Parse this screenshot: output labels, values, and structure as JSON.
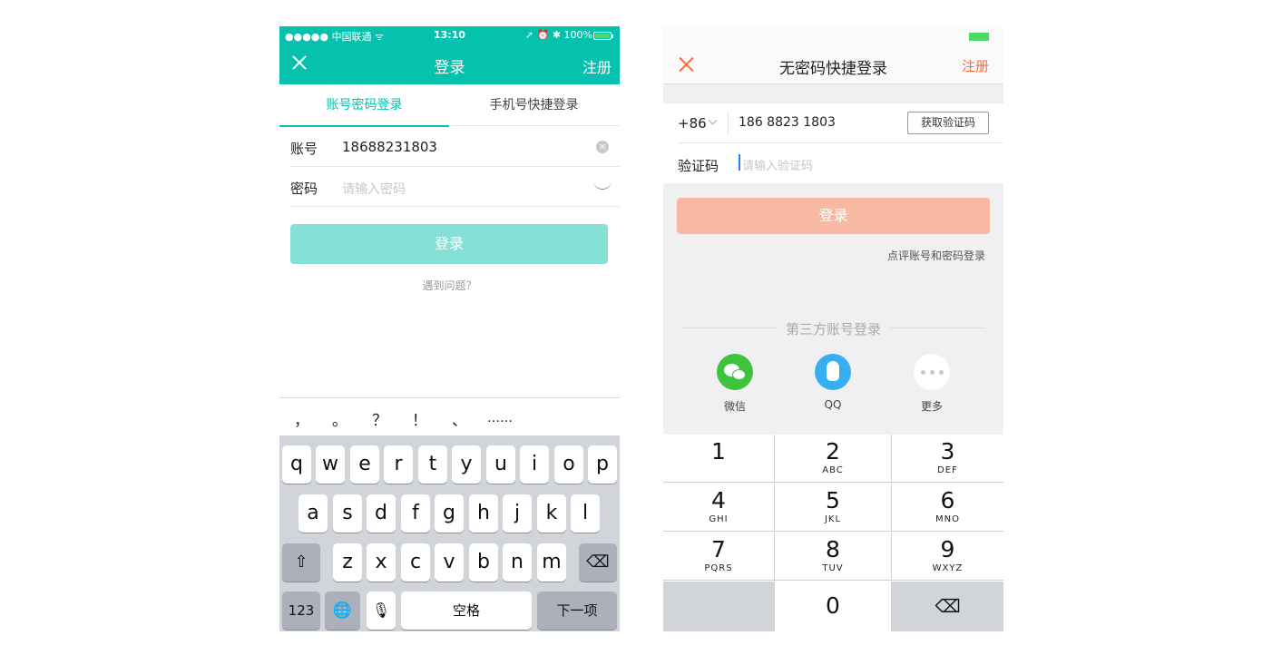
{
  "left": {
    "status_bar": {
      "carrier": "●●●●● 中国联通 ᯤ",
      "time": "13:10",
      "right": "➚ ⏰ ✱ 100%"
    },
    "nav": {
      "title": "登录",
      "action": "注册"
    },
    "tabs": [
      {
        "label": "账号密码登录"
      },
      {
        "label": "手机号快捷登录"
      }
    ],
    "account": {
      "label": "账号",
      "value": "18688231803"
    },
    "password": {
      "label": "密码",
      "placeholder": "请输入密码"
    },
    "login_button": "登录",
    "help_link": "遇到问题？",
    "punctuation": [
      "，",
      "。",
      "？",
      "！",
      "、",
      "……"
    ],
    "keyboard": {
      "row1": [
        "q",
        "w",
        "e",
        "r",
        "t",
        "y",
        "u",
        "i",
        "o",
        "p"
      ],
      "row2": [
        "a",
        "s",
        "d",
        "f",
        "g",
        "h",
        "j",
        "k",
        "l"
      ],
      "row3": [
        "z",
        "x",
        "c",
        "v",
        "b",
        "n",
        "m"
      ],
      "shift": "⇧",
      "delete": "⌫",
      "numbers": "123",
      "globe": "🌐",
      "mic": "🎙",
      "space": "空格",
      "next": "下一项"
    }
  },
  "right": {
    "nav": {
      "title": "无密码快捷登录",
      "action": "注册"
    },
    "phone": {
      "country_code": "+86",
      "value": "186 8823 1803",
      "get_code": "获取验证码"
    },
    "code": {
      "label": "验证码",
      "placeholder": "请输入验证码"
    },
    "login_button": "登录",
    "password_login_link": "点评账号和密码登录",
    "third_party_title": "第三方账号登录",
    "social": [
      {
        "label": "微信"
      },
      {
        "label": "QQ"
      },
      {
        "label": "更多"
      }
    ],
    "numpad": [
      {
        "digit": "1",
        "letters": ""
      },
      {
        "digit": "2",
        "letters": "ABC"
      },
      {
        "digit": "3",
        "letters": "DEF"
      },
      {
        "digit": "4",
        "letters": "GHI"
      },
      {
        "digit": "5",
        "letters": "JKL"
      },
      {
        "digit": "6",
        "letters": "MNO"
      },
      {
        "digit": "7",
        "letters": "PQRS"
      },
      {
        "digit": "8",
        "letters": "TUV"
      },
      {
        "digit": "9",
        "letters": "WXYZ"
      },
      {
        "digit": "0",
        "letters": ""
      }
    ],
    "delete": "⌫"
  },
  "colors": {
    "green_accent": "#06c1ae",
    "orange_accent": "#ff6633",
    "login_green_disabled": "#85e0d6",
    "login_orange_disabled": "#f8b9a3"
  }
}
